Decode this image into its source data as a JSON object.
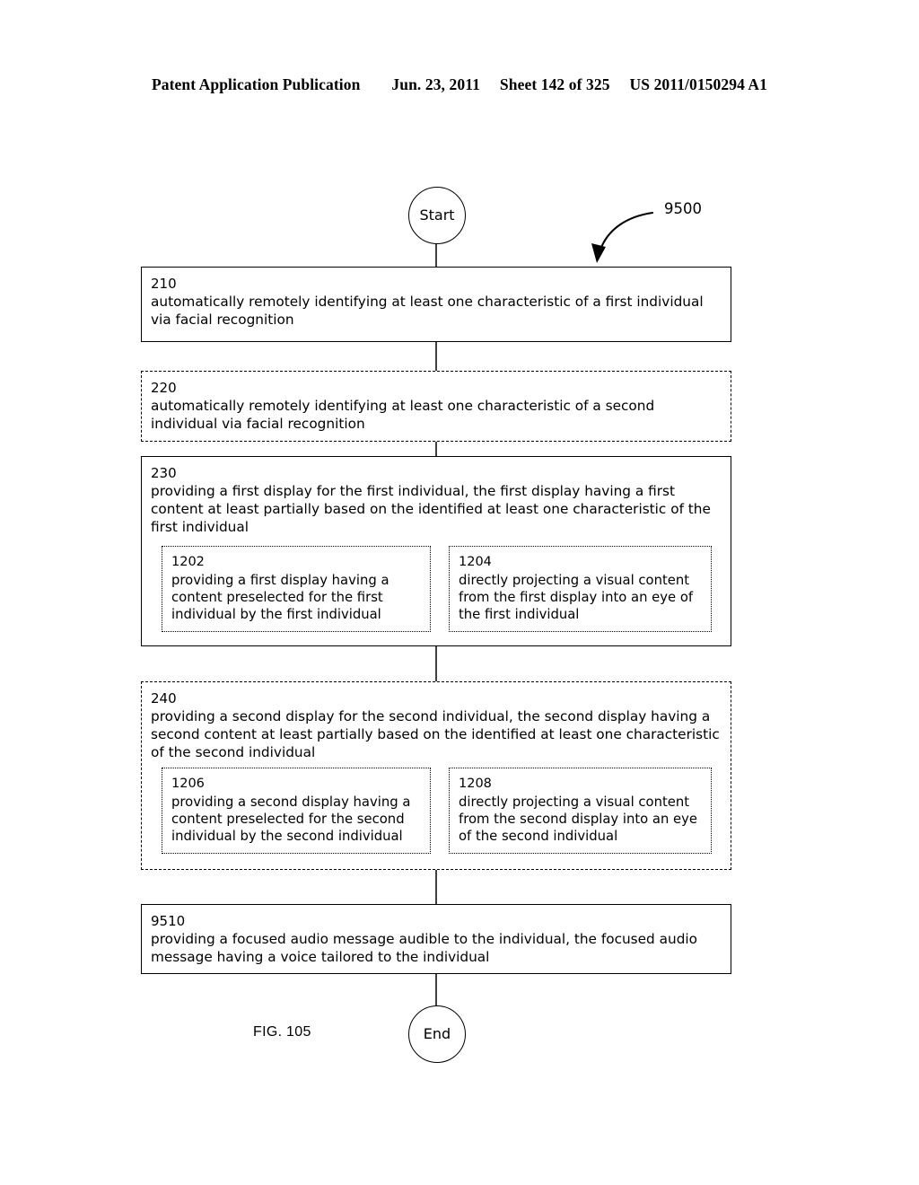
{
  "header": {
    "publication": "Patent Application Publication",
    "date": "Jun. 23, 2011",
    "sheet": "Sheet 142 of 325",
    "patent_number": "US 2011/0150294 A1"
  },
  "figure": {
    "label": "FIG. 105",
    "reference_numeral": "9500"
  },
  "terminators": {
    "start": "Start",
    "end": "End"
  },
  "steps": [
    {
      "id": "210",
      "number": "210",
      "text": "automatically remotely identifying at least one characteristic of a first individual via facial recognition",
      "border": "solid"
    },
    {
      "id": "220",
      "number": "220",
      "text": "automatically remotely identifying at least one characteristic of a second individual via facial recognition",
      "border": "dashed"
    },
    {
      "id": "230",
      "number": "230",
      "text": "providing a first display for the first individual, the first display having a first content at least partially based on the identified at least one characteristic of the first individual",
      "border": "solid",
      "substeps": [
        {
          "id": "1202",
          "number": "1202",
          "text": "providing a first display having a content preselected for the first individual by the first individual"
        },
        {
          "id": "1204",
          "number": "1204",
          "text": "directly projecting a visual content from the first display into an eye of the first individual"
        }
      ]
    },
    {
      "id": "240",
      "number": "240",
      "text": "providing a second display for the second individual, the second display having a second content at least partially based on the identified at least one characteristic of the second individual",
      "border": "dashed",
      "substeps": [
        {
          "id": "1206",
          "number": "1206",
          "text": "providing a second display having a content preselected for the second individual by the second individual"
        },
        {
          "id": "1208",
          "number": "1208",
          "text": "directly projecting a visual content from the second display into an eye of the second individual"
        }
      ]
    },
    {
      "id": "9510",
      "number": "9510",
      "text": "providing a focused audio message audible to the individual, the focused audio message having a voice tailored to the individual",
      "border": "solid"
    }
  ],
  "colors": {
    "ink": "#000000",
    "paper": "#ffffff"
  }
}
